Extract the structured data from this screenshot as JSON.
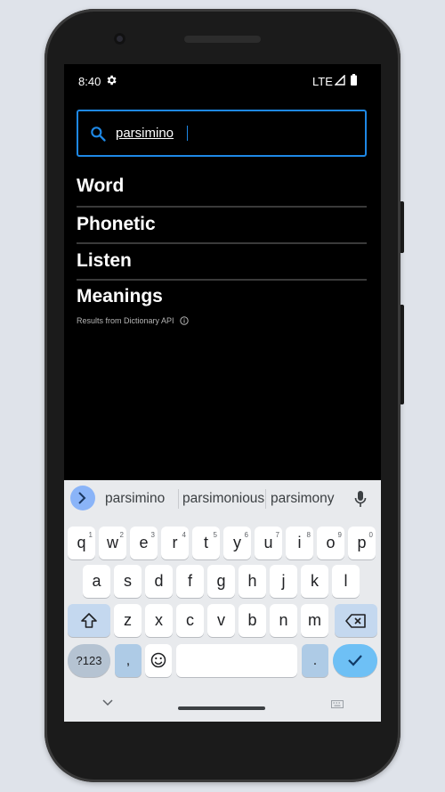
{
  "status_bar": {
    "time": "8:40",
    "network": "LTE",
    "icons": [
      "gear-icon",
      "signal-icon",
      "battery-icon"
    ]
  },
  "search": {
    "value": "parsimino",
    "icon": "search-icon",
    "accent_color": "#1e88e5"
  },
  "sections": {
    "word": "Word",
    "phonetic": "Phonetic",
    "listen": "Listen",
    "meanings": "Meanings"
  },
  "attribution": "Results from Dictionary API",
  "keyboard": {
    "suggestions": [
      "parsimino",
      "parsimonious",
      "parsimony"
    ],
    "row1": [
      {
        "k": "q",
        "h": "1"
      },
      {
        "k": "w",
        "h": "2"
      },
      {
        "k": "e",
        "h": "3"
      },
      {
        "k": "r",
        "h": "4"
      },
      {
        "k": "t",
        "h": "5"
      },
      {
        "k": "y",
        "h": "6"
      },
      {
        "k": "u",
        "h": "7"
      },
      {
        "k": "i",
        "h": "8"
      },
      {
        "k": "o",
        "h": "9"
      },
      {
        "k": "p",
        "h": "0"
      }
    ],
    "row2": [
      "a",
      "s",
      "d",
      "f",
      "g",
      "h",
      "j",
      "k",
      "l"
    ],
    "row3": [
      "z",
      "x",
      "c",
      "v",
      "b",
      "n",
      "m"
    ],
    "mode_key": "?123",
    "comma_key": ",",
    "period_key": ".",
    "enter_color": "#6ec0f5"
  }
}
